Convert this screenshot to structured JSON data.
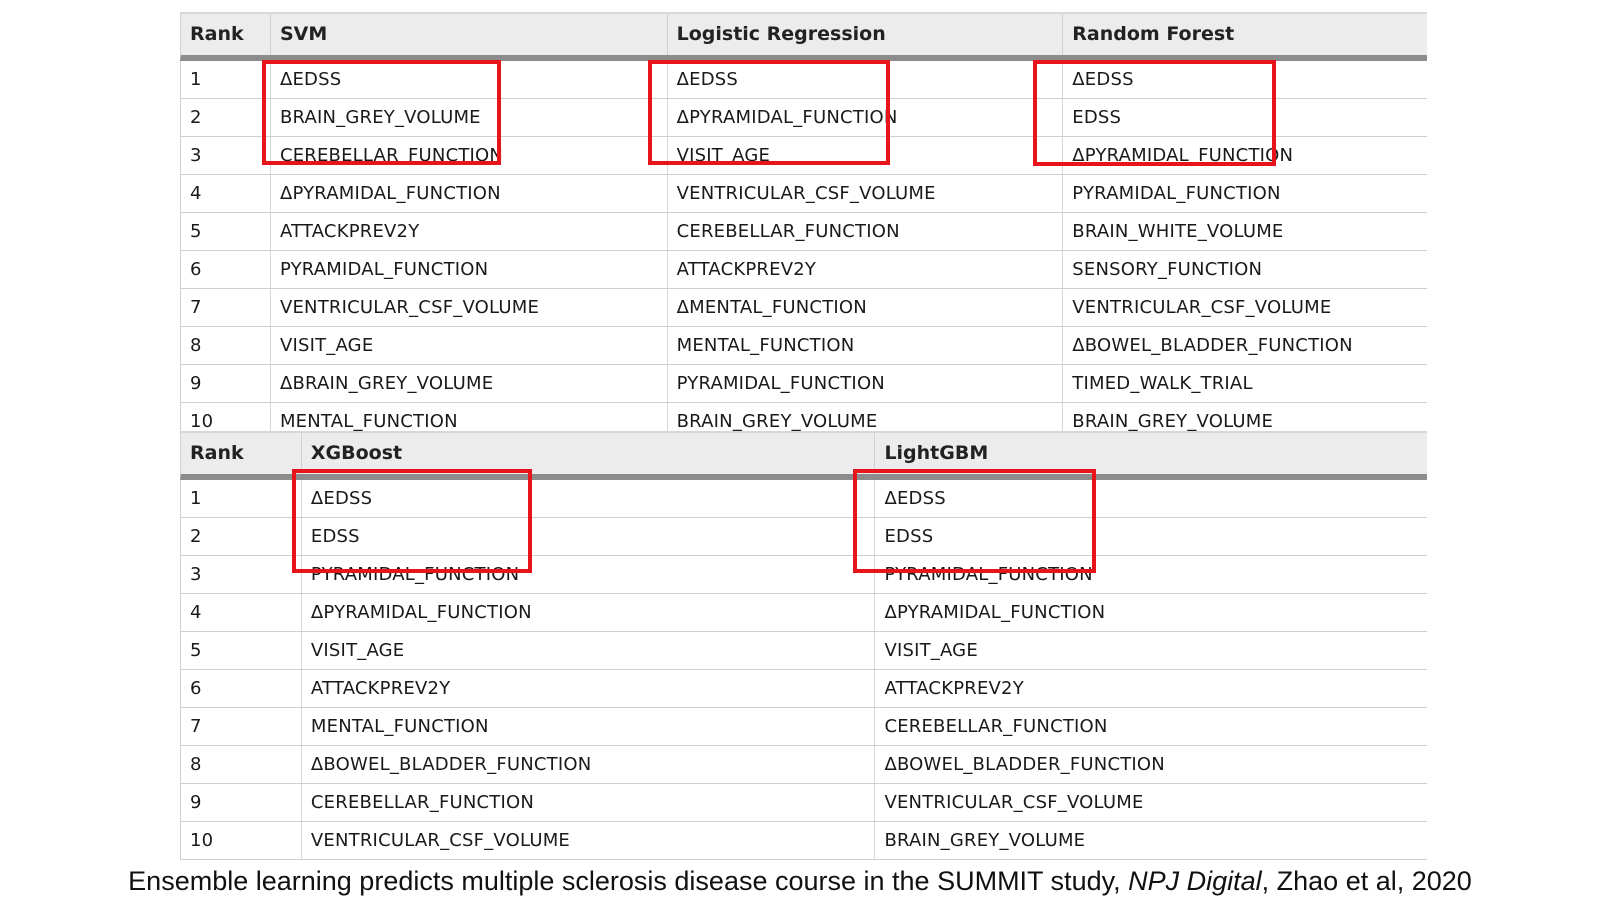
{
  "top_table": {
    "headers": [
      "Rank",
      "SVM",
      "Logistic Regression",
      "Random Forest"
    ],
    "rows": [
      [
        "1",
        "ΔEDSS",
        "ΔEDSS",
        "ΔEDSS"
      ],
      [
        "2",
        "BRAIN_GREY_VOLUME",
        "ΔPYRAMIDAL_FUNCTION",
        "EDSS"
      ],
      [
        "3",
        "CEREBELLAR_FUNCTION",
        "VISIT_AGE",
        "ΔPYRAMIDAL_FUNCTION"
      ],
      [
        "4",
        "ΔPYRAMIDAL_FUNCTION",
        "VENTRICULAR_CSF_VOLUME",
        "PYRAMIDAL_FUNCTION"
      ],
      [
        "5",
        "ATTACKPREV2Y",
        "CEREBELLAR_FUNCTION",
        "BRAIN_WHITE_VOLUME"
      ],
      [
        "6",
        "PYRAMIDAL_FUNCTION",
        "ATTACKPREV2Y",
        "SENSORY_FUNCTION"
      ],
      [
        "7",
        "VENTRICULAR_CSF_VOLUME",
        "ΔMENTAL_FUNCTION",
        "VENTRICULAR_CSF_VOLUME"
      ],
      [
        "8",
        "VISIT_AGE",
        "MENTAL_FUNCTION",
        "ΔBOWEL_BLADDER_FUNCTION"
      ],
      [
        "9",
        "ΔBRAIN_GREY_VOLUME",
        "PYRAMIDAL_FUNCTION",
        "TIMED_WALK_TRIAL"
      ],
      [
        "10",
        "MENTAL_FUNCTION",
        "BRAIN_GREY_VOLUME",
        "BRAIN_GREY_VOLUME"
      ]
    ]
  },
  "bottom_table": {
    "headers": [
      "Rank",
      "XGBoost",
      "LightGBM"
    ],
    "rows": [
      [
        "1",
        "ΔEDSS",
        "ΔEDSS"
      ],
      [
        "2",
        "EDSS",
        "EDSS"
      ],
      [
        "3",
        "PYRAMIDAL_FUNCTION",
        "PYRAMIDAL_FUNCTION"
      ],
      [
        "4",
        "ΔPYRAMIDAL_FUNCTION",
        "ΔPYRAMIDAL_FUNCTION"
      ],
      [
        "5",
        "VISIT_AGE",
        "VISIT_AGE"
      ],
      [
        "6",
        "ATTACKPREV2Y",
        "ATTACKPREV2Y"
      ],
      [
        "7",
        "MENTAL_FUNCTION",
        "CEREBELLAR_FUNCTION"
      ],
      [
        "8",
        "ΔBOWEL_BLADDER_FUNCTION",
        "ΔBOWEL_BLADDER_FUNCTION"
      ],
      [
        "9",
        "CEREBELLAR_FUNCTION",
        "VENTRICULAR_CSF_VOLUME"
      ],
      [
        "10",
        "VENTRICULAR_CSF_VOLUME",
        "BRAIN_GREY_VOLUME"
      ]
    ]
  },
  "highlight": {
    "color": "#e8141c",
    "ranks_highlighted": [
      "1",
      "2",
      "3"
    ]
  },
  "caption": {
    "part1": "Ensemble learning predicts multiple sclerosis disease course in the SUMMIT study, ",
    "journal": "NPJ Digital",
    "part2": ", Zhao et al, 2020"
  }
}
